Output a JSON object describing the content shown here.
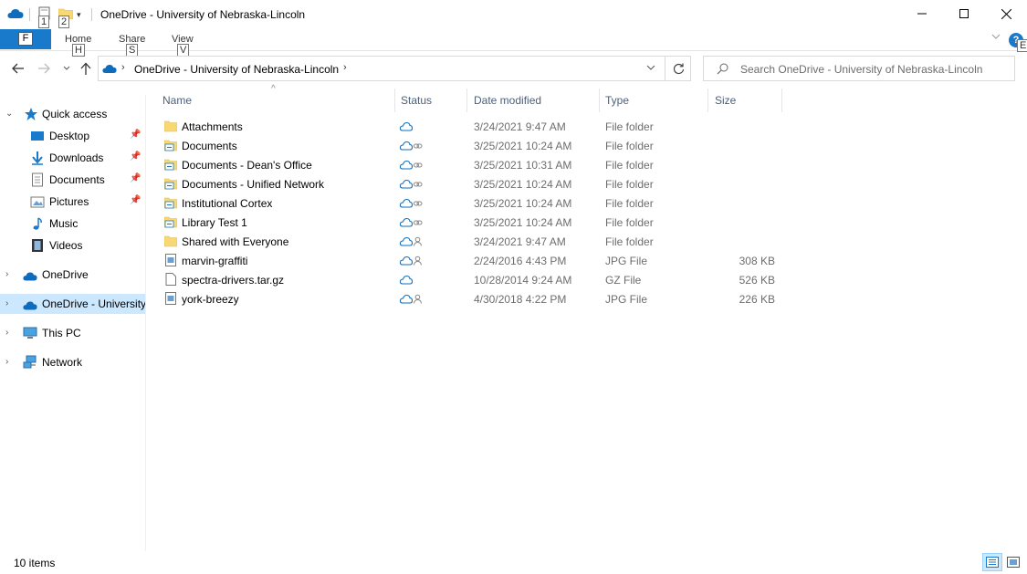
{
  "window": {
    "title": "OneDrive - University of Nebraska-Lincoln",
    "keytips": {
      "properties": "1",
      "new_folder": "2",
      "home": "H",
      "share": "S",
      "view": "V",
      "help": "E"
    }
  },
  "ribbon": {
    "file_key": "F",
    "tabs": [
      {
        "label": "Home"
      },
      {
        "label": "Share"
      },
      {
        "label": "View"
      }
    ],
    "help_label": "?"
  },
  "address": {
    "crumb": "OneDrive - University of Nebraska-Lincoln",
    "search_placeholder": "Search OneDrive - University of Nebraska-Lincoln"
  },
  "nav": {
    "quick_access": "Quick access",
    "quick_items": [
      {
        "label": "Desktop",
        "icon": "desktop-icon"
      },
      {
        "label": "Downloads",
        "icon": "downloads-icon"
      },
      {
        "label": "Documents",
        "icon": "documents-icon"
      },
      {
        "label": "Pictures",
        "icon": "pictures-icon"
      },
      {
        "label": "Music",
        "icon": "music-icon"
      },
      {
        "label": "Videos",
        "icon": "videos-icon"
      }
    ],
    "onedrive": "OneDrive",
    "onedrive_univ": "OneDrive - University of Nebraska-Lincoln",
    "this_pc": "This PC",
    "network": "Network"
  },
  "columns": {
    "name": "Name",
    "status": "Status",
    "date": "Date modified",
    "type": "Type",
    "size": "Size"
  },
  "files": [
    {
      "name": "Attachments",
      "status": "cloud",
      "date": "3/24/2021 9:47 AM",
      "type": "File folder",
      "size": "",
      "kind": "folder"
    },
    {
      "name": "Documents",
      "status": "cloud-link",
      "date": "3/25/2021 10:24 AM",
      "type": "File folder",
      "size": "",
      "kind": "folder-link"
    },
    {
      "name": "Documents - Dean's Office",
      "status": "cloud-link",
      "date": "3/25/2021 10:31 AM",
      "type": "File folder",
      "size": "",
      "kind": "folder-link"
    },
    {
      "name": "Documents - Unified Network",
      "status": "cloud-link",
      "date": "3/25/2021 10:24 AM",
      "type": "File folder",
      "size": "",
      "kind": "folder-link"
    },
    {
      "name": "Institutional Cortex",
      "status": "cloud-link",
      "date": "3/25/2021 10:24 AM",
      "type": "File folder",
      "size": "",
      "kind": "folder-link"
    },
    {
      "name": "Library Test 1",
      "status": "cloud-link",
      "date": "3/25/2021 10:24 AM",
      "type": "File folder",
      "size": "",
      "kind": "folder-link"
    },
    {
      "name": "Shared with Everyone",
      "status": "cloud-shared",
      "date": "3/24/2021 9:47 AM",
      "type": "File folder",
      "size": "",
      "kind": "folder"
    },
    {
      "name": "marvin-graffiti",
      "status": "cloud-shared",
      "date": "2/24/2016 4:43 PM",
      "type": "JPG File",
      "size": "308 KB",
      "kind": "image"
    },
    {
      "name": "spectra-drivers.tar.gz",
      "status": "cloud",
      "date": "10/28/2014 9:24 AM",
      "type": "GZ File",
      "size": "526 KB",
      "kind": "file"
    },
    {
      "name": "york-breezy",
      "status": "cloud-shared",
      "date": "4/30/2018 4:22 PM",
      "type": "JPG File",
      "size": "226 KB",
      "kind": "image"
    }
  ],
  "status_bar": {
    "count": "10 items"
  },
  "colors": {
    "accent": "#1979ca",
    "selection": "#cce8ff",
    "folder": "#f8d775",
    "cloud": "#0f6cbd"
  }
}
